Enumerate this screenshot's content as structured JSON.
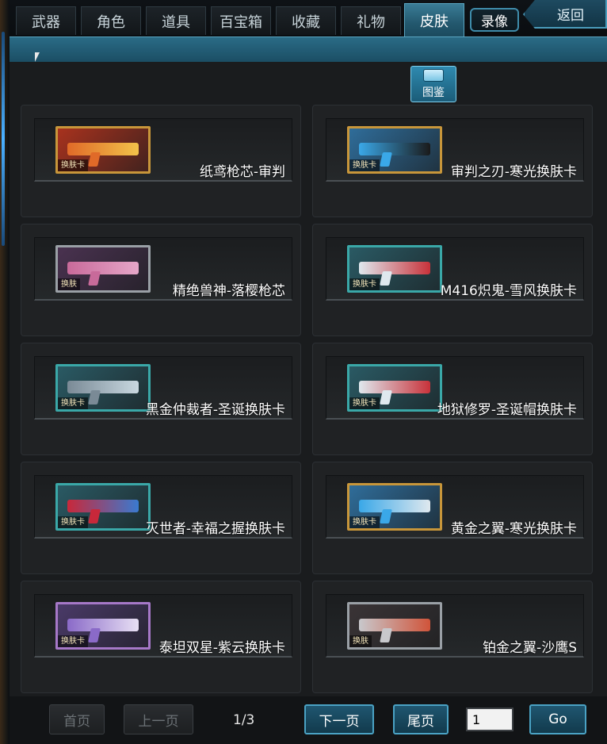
{
  "tabs": [
    {
      "label": "武器",
      "active": false
    },
    {
      "label": "角色",
      "active": false
    },
    {
      "label": "道具",
      "active": false
    },
    {
      "label": "百宝箱",
      "active": false
    },
    {
      "label": "收藏",
      "active": false
    },
    {
      "label": "礼物",
      "active": false
    },
    {
      "label": "皮肤",
      "active": true
    }
  ],
  "record_label": "录像",
  "back_label": "返回",
  "atlas_label": "图鉴",
  "items": [
    {
      "name": "纸鸢枪芯-审判",
      "tag": "换肤卡",
      "frame": "#c8963a",
      "bg": "#a8321e",
      "gun": "#e06a28",
      "accent": "#f2c24a"
    },
    {
      "name": "审判之刃-寒光换肤卡",
      "tag": "换肤卡",
      "frame": "#c8963a",
      "bg": "#2f6d9a",
      "gun": "#3aa8e8",
      "accent": "#1a1a1a"
    },
    {
      "name": "精绝兽神-落樱枪芯",
      "tag": "换肤",
      "frame": "#9aa0a6",
      "bg": "#4a3250",
      "gun": "#c86a9a",
      "accent": "#e6a6c8"
    },
    {
      "name": "M416炽鬼-雪风换肤卡",
      "tag": "换肤卡",
      "frame": "#3aa8a8",
      "bg": "#2a5a64",
      "gun": "#dfe8ee",
      "accent": "#c8323a"
    },
    {
      "name": "黑金仲裁者-圣诞换肤卡",
      "tag": "换肤卡",
      "frame": "#3aa8a8",
      "bg": "#2a5a64",
      "gun": "#7a8a96",
      "accent": "#c8d8e0"
    },
    {
      "name": "地狱修罗-圣诞帽换肤卡",
      "tag": "换肤卡",
      "frame": "#3aa8a8",
      "bg": "#2a5a64",
      "gun": "#dfe8ee",
      "accent": "#c8323a"
    },
    {
      "name": "灭世者-幸福之握换肤卡",
      "tag": "换肤卡",
      "frame": "#3aa8a8",
      "bg": "#2a5a64",
      "gun": "#c8283a",
      "accent": "#3a7ad0"
    },
    {
      "name": "黄金之翼-寒光换肤卡",
      "tag": "换肤卡",
      "frame": "#c8963a",
      "bg": "#2f6d9a",
      "gun": "#3aa8e8",
      "accent": "#dfe8ee"
    },
    {
      "name": "泰坦双星-紫云换肤卡",
      "tag": "换肤卡",
      "frame": "#a678c8",
      "bg": "#4a3a68",
      "gun": "#8a6ac8",
      "accent": "#e8e0f4"
    },
    {
      "name": "铂金之翼-沙鹰S",
      "tag": "换肤",
      "frame": "#9aa0a6",
      "bg": "#3a3436",
      "gun": "#c8c8cc",
      "accent": "#d0543a"
    }
  ],
  "pager": {
    "first": "首页",
    "prev": "上一页",
    "indicator": "1/3",
    "next": "下一页",
    "last": "尾页",
    "page_value": "1",
    "go": "Go"
  }
}
